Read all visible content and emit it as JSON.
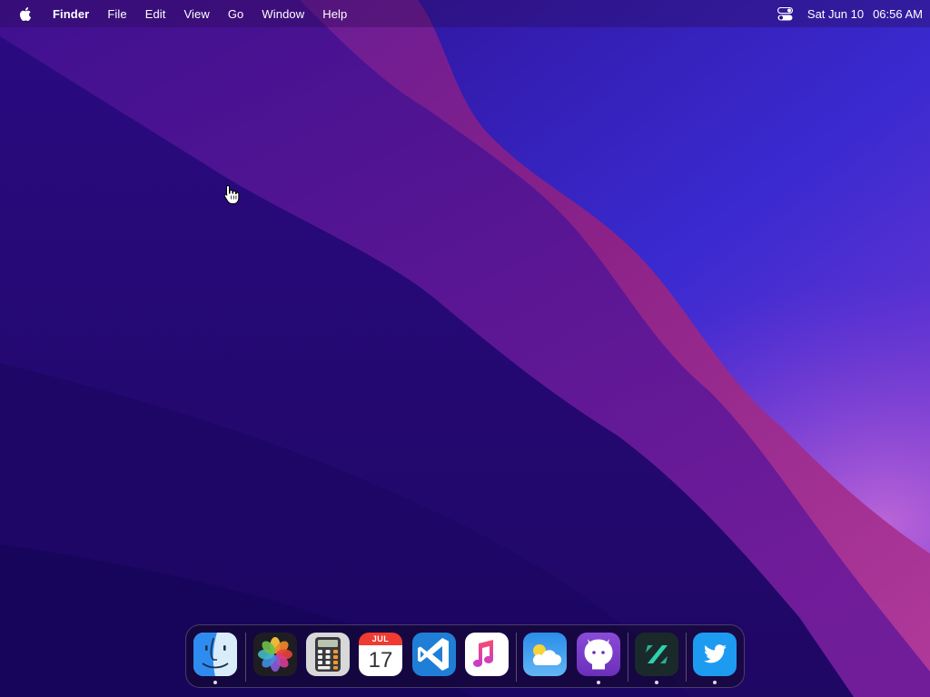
{
  "menubar": {
    "apple_icon": "apple-logo-icon",
    "app_name": "Finder",
    "menus": [
      "File",
      "Edit",
      "View",
      "Go",
      "Window",
      "Help"
    ],
    "control_center_icon": "control-center-icon",
    "date": "Sat Jun 10",
    "time": "06:56 AM"
  },
  "cursor": {
    "icon": "hand-pointer-icon"
  },
  "dock": {
    "apps": [
      {
        "name": "Finder",
        "icon": "finder-icon",
        "running": true
      },
      {
        "name": "Photos",
        "icon": "photos-icon",
        "running": false
      },
      {
        "name": "Calculator",
        "icon": "calculator-icon",
        "running": false
      },
      {
        "name": "Calendar",
        "icon": "calendar-icon",
        "running": false,
        "month": "JUL",
        "day": "17"
      },
      {
        "name": "Visual Studio Code",
        "icon": "vscode-icon",
        "running": false
      },
      {
        "name": "Music",
        "icon": "music-icon",
        "running": false
      },
      {
        "name": "Weather",
        "icon": "weather-icon",
        "running": false
      },
      {
        "name": "GitHub Desktop",
        "icon": "github-icon",
        "running": true
      },
      {
        "name": "Scrivener-style app",
        "icon": "s-app-icon",
        "running": true
      },
      {
        "name": "Twitter",
        "icon": "twitter-icon",
        "running": true
      }
    ]
  },
  "colors": {
    "wallpaper_base": "#2a0c7a",
    "wallpaper_dark": "#1d0760",
    "wallpaper_magenta": "#8a1f86",
    "wallpaper_blue": "#3b2fd6",
    "menubar_text": "#ffffff"
  }
}
